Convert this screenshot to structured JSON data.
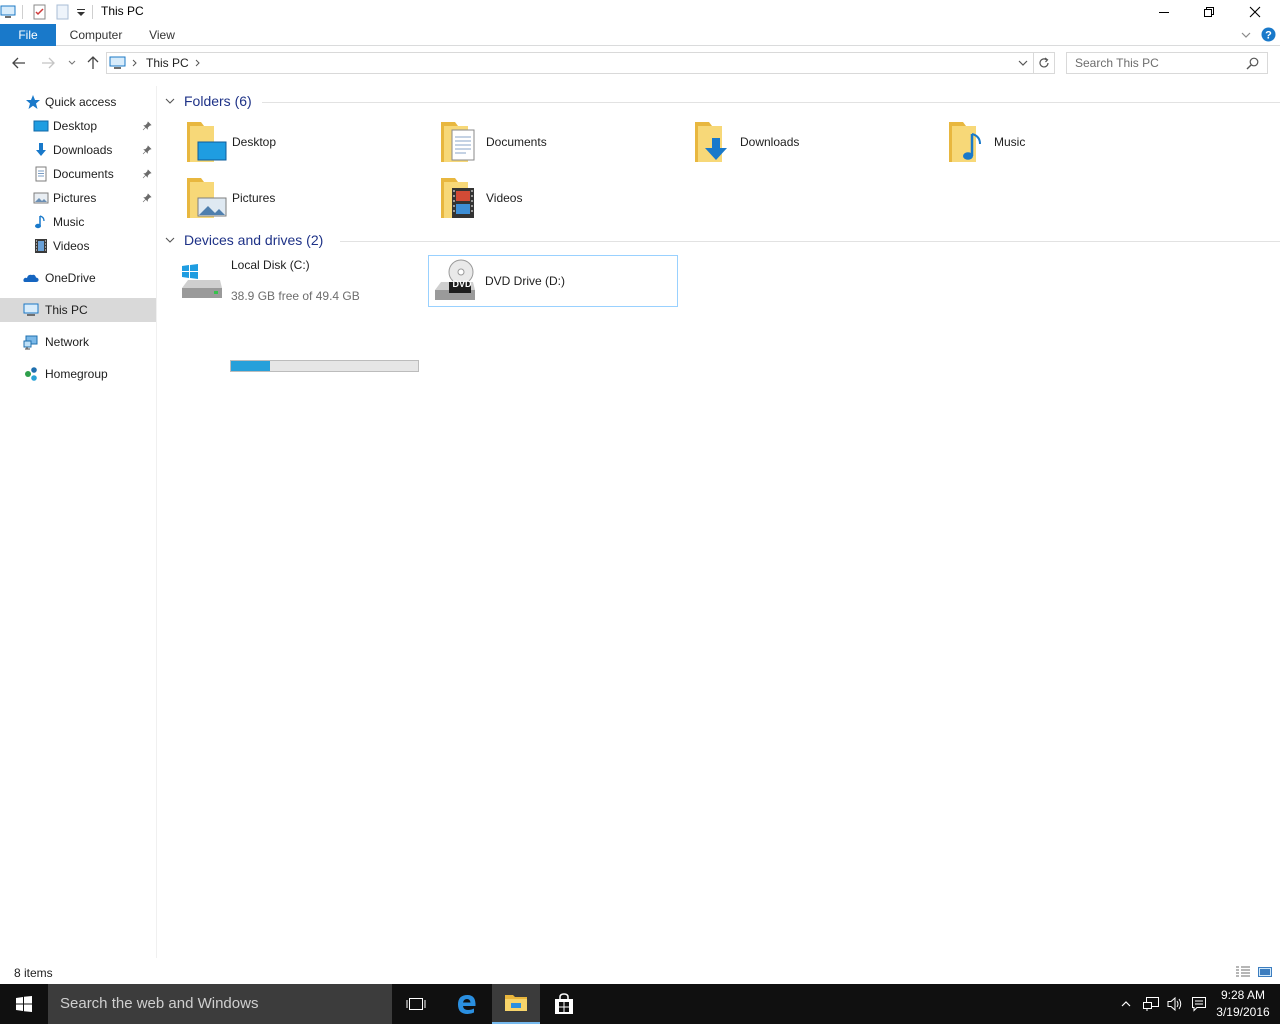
{
  "window": {
    "title": "This PC"
  },
  "ribbon": {
    "tabs": [
      "File",
      "Computer",
      "View"
    ]
  },
  "address": {
    "path": [
      "This PC"
    ]
  },
  "search": {
    "placeholder": "Search This PC"
  },
  "nav": {
    "quick_access": "Quick access",
    "pinned": [
      {
        "label": "Desktop",
        "icon": "desktop-icon",
        "pinned": true
      },
      {
        "label": "Downloads",
        "icon": "downloads-icon",
        "pinned": true
      },
      {
        "label": "Documents",
        "icon": "documents-icon",
        "pinned": true
      },
      {
        "label": "Pictures",
        "icon": "pictures-icon",
        "pinned": true
      },
      {
        "label": "Music",
        "icon": "music-icon",
        "pinned": false
      },
      {
        "label": "Videos",
        "icon": "videos-icon",
        "pinned": false
      }
    ],
    "onedrive": "OneDrive",
    "this_pc": "This PC",
    "network": "Network",
    "homegroup": "Homegroup"
  },
  "folders": {
    "title": "Folders (6)",
    "items": [
      "Desktop",
      "Documents",
      "Downloads",
      "Music",
      "Pictures",
      "Videos"
    ]
  },
  "drives": {
    "title": "Devices and drives (2)",
    "local": {
      "name": "Local Disk (C:)",
      "free_text": "38.9 GB free of 49.4 GB",
      "used_fraction": 0.21
    },
    "dvd": {
      "name": "DVD Drive (D:)",
      "badge": "DVD"
    }
  },
  "status": {
    "count": "8 items"
  },
  "taskbar": {
    "search_placeholder": "Search the web and Windows",
    "time": "9:28 AM",
    "date": "3/19/2016"
  },
  "colors": {
    "accent": "#1979ca",
    "folder": "#f5cf62",
    "drive_fill": "#26a0da",
    "taskbar": "#101010"
  }
}
